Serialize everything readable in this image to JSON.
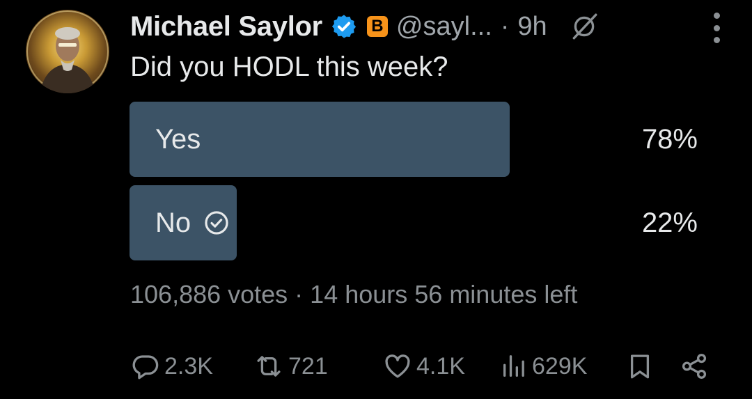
{
  "tweet": {
    "author_name": "Michael Saylor",
    "affiliate_badge": "B",
    "handle": "@sayl...",
    "separator": "·",
    "time": "9h",
    "text": "Did you HODL this week?"
  },
  "poll": {
    "options": [
      {
        "label": "Yes",
        "percent_text": "78%",
        "percent": 78,
        "selected": false
      },
      {
        "label": "No",
        "percent_text": "22%",
        "percent": 22,
        "selected": true
      }
    ],
    "meta": "106,886 votes · 14 hours 56 minutes left",
    "fill_color": "#3c5366"
  },
  "actions": {
    "replies": "2.3K",
    "reposts": "721",
    "likes": "4.1K",
    "views": "629K"
  },
  "icons": {
    "verified": "verified-badge-icon",
    "grok": "grok-icon",
    "more": "more-icon",
    "reply": "reply-icon",
    "repost": "repost-icon",
    "like": "like-icon",
    "views": "views-icon",
    "bookmark": "bookmark-icon",
    "share": "share-icon"
  },
  "colors": {
    "background": "#000000",
    "text": "#e7e9ea",
    "muted": "#8b9094",
    "verified": "#1d9bf0",
    "bitcoin": "#f7931a"
  }
}
